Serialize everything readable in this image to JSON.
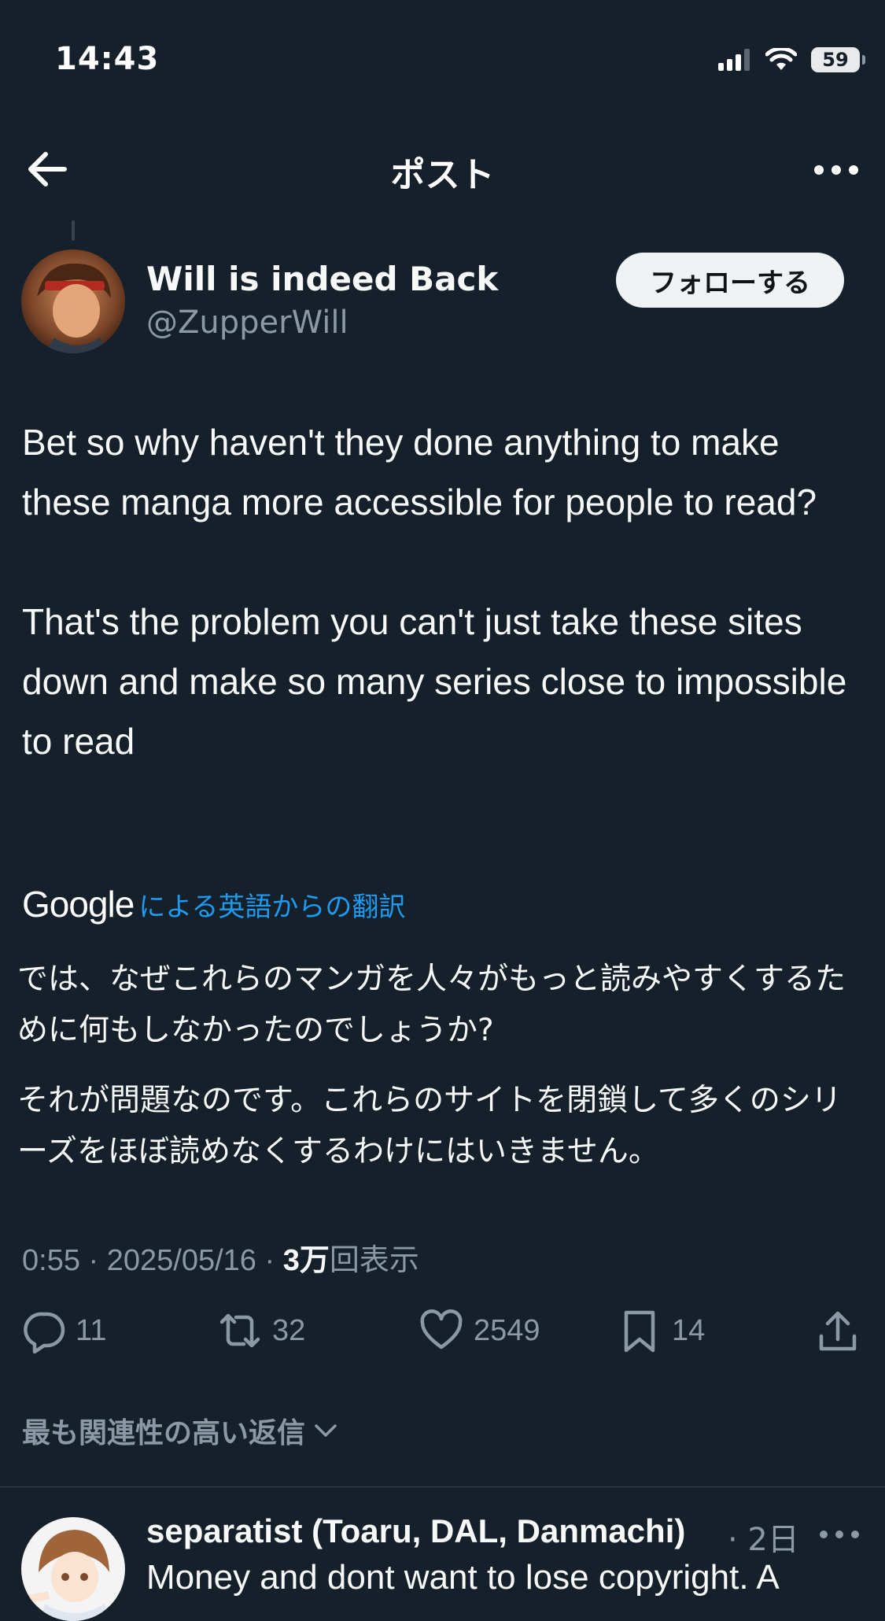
{
  "status_bar": {
    "time": "14:43",
    "battery": "59"
  },
  "header": {
    "title": "ポスト"
  },
  "post": {
    "author_name": "Will is indeed Back",
    "author_handle": "@ZupperWill",
    "follow_label": "フォローする",
    "paragraphs": [
      "Bet so why haven't they done anything to make these manga more accessible for people to read?",
      "That's the problem you can't just take these sites down and make so many series close to impossible to read"
    ],
    "translation_brand": "Google",
    "translation_label": "による英語からの翻訳",
    "translated_paragraphs": [
      "では、なぜこれらのマンガを人々がもっと読みやすくするために何もしなかったのでしょうか?",
      "それが問題なのです。これらのサイトを閉鎖して多くのシリーズをほぼ読めなくするわけにはいきません。"
    ],
    "time": "0:55",
    "date": "2025/05/16",
    "views_count": "3万",
    "views_label": "回表示",
    "separator": "·"
  },
  "actions": {
    "replies": "11",
    "reposts": "32",
    "likes": "2549",
    "bookmarks": "14"
  },
  "replies_sort": {
    "label": "最も関連性の高い返信"
  },
  "reply": {
    "author_name": "separatist (Toaru, DAL, Danmachi)",
    "time": "· 2日",
    "text": "Money and dont want to lose copyright. A"
  },
  "colors": {
    "background": "#15202b",
    "text": "#f7f9f9",
    "muted": "#8b98a5",
    "accent": "#1d9bf0"
  }
}
